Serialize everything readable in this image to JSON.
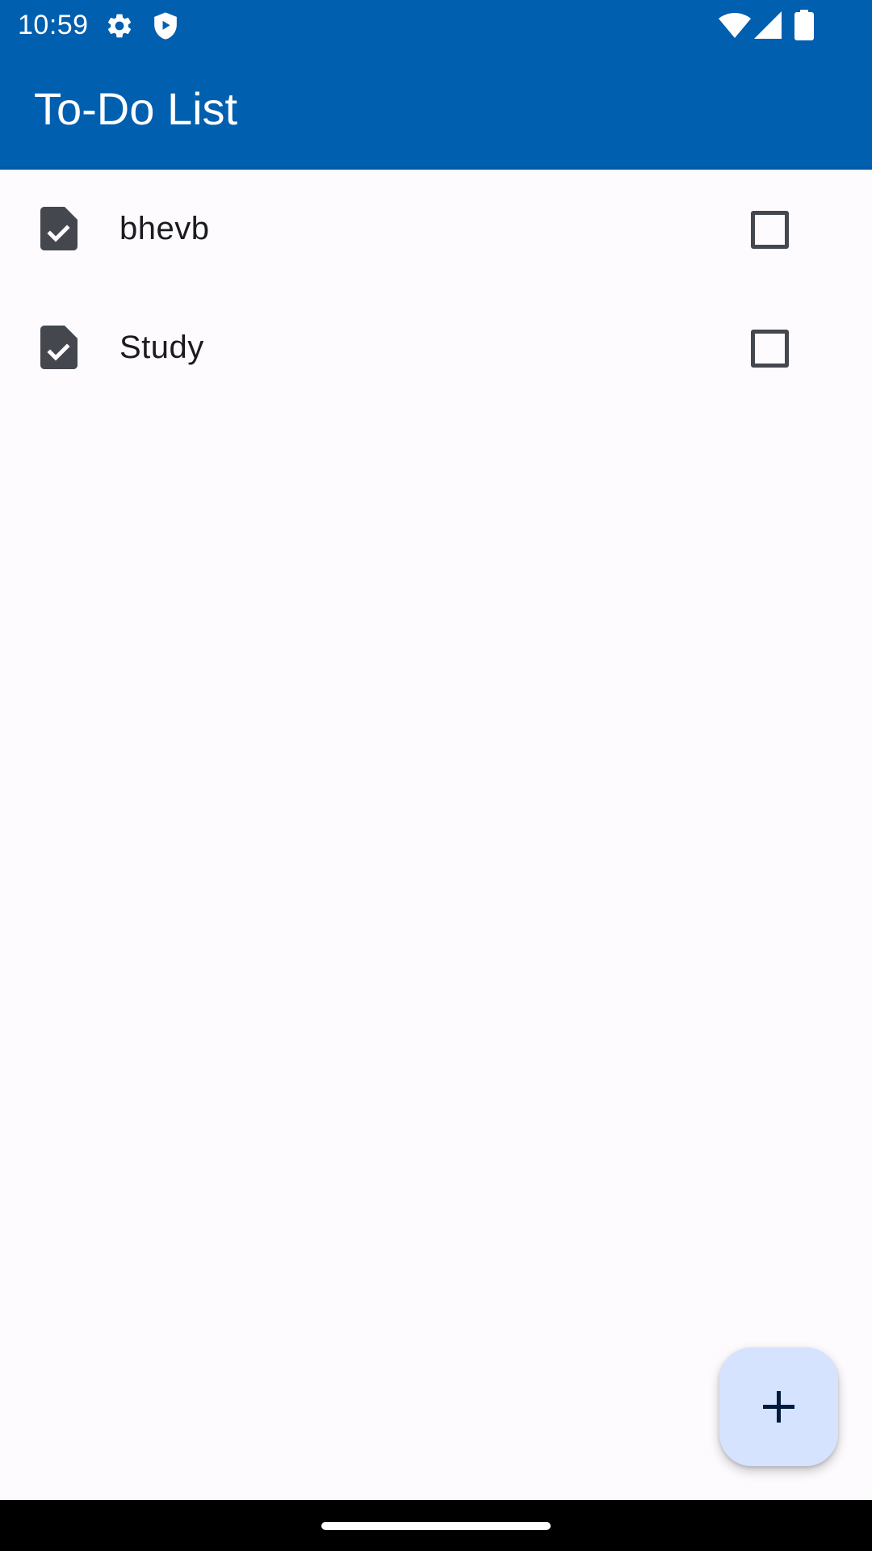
{
  "status_bar": {
    "time": "10:59",
    "icons_left": [
      "gear-icon",
      "shield-play-icon"
    ],
    "icons_right": [
      "wifi-icon",
      "signal-icon",
      "battery-icon"
    ]
  },
  "app_bar": {
    "title": "To-Do List"
  },
  "todos": [
    {
      "label": "bhevb",
      "icon": "task-document-icon",
      "checked": false
    },
    {
      "label": "Study",
      "icon": "task-document-icon",
      "checked": false
    }
  ],
  "fab": {
    "icon": "plus-icon",
    "action": "add task"
  },
  "colors": {
    "primary": "#005faf",
    "background": "#fefbff",
    "fab_container": "#d6e3ff",
    "on_surface": "#1b1b1f",
    "icon": "#44474e"
  }
}
